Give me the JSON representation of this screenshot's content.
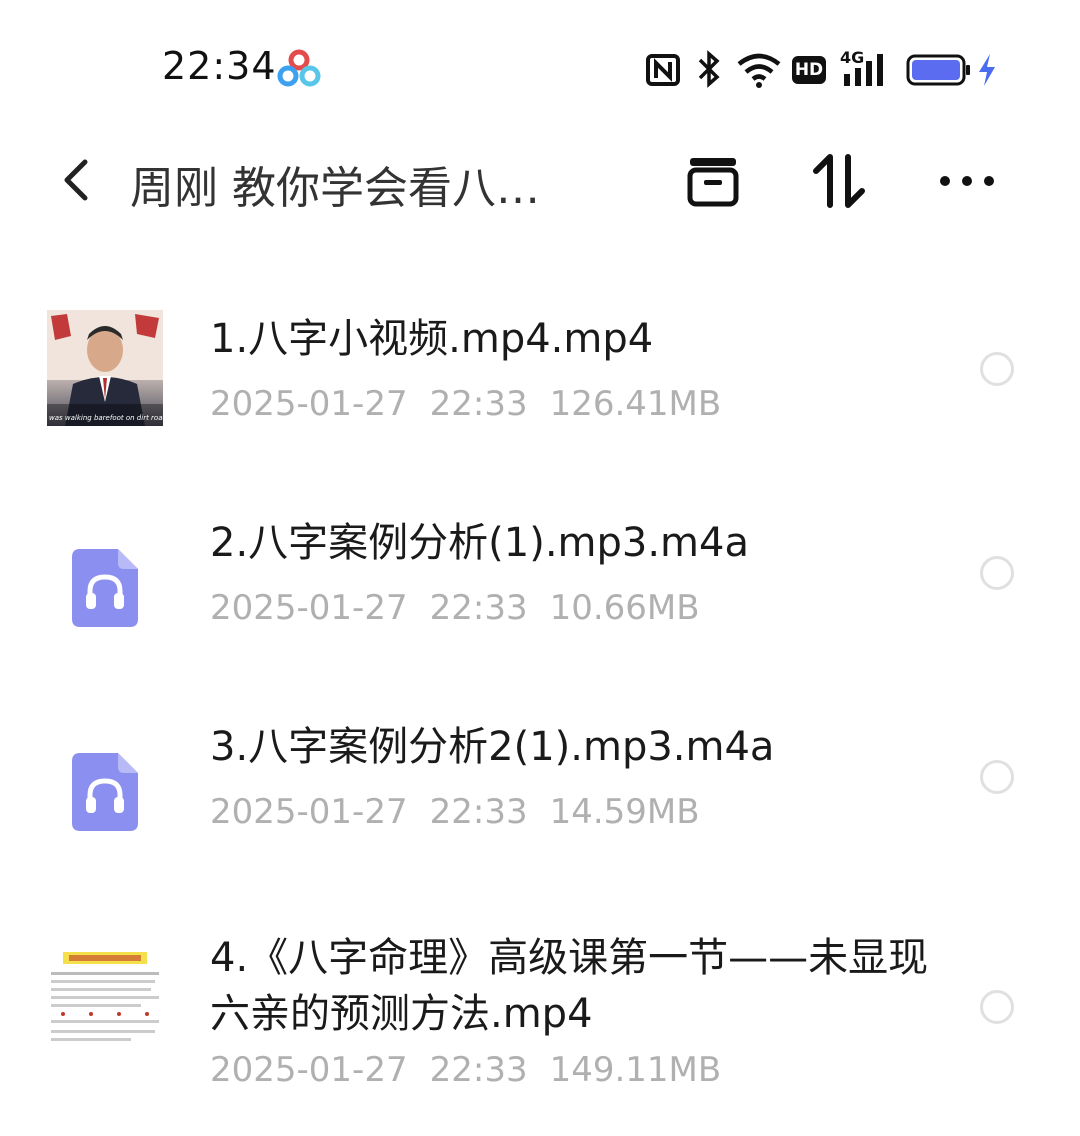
{
  "status_bar": {
    "time": "22:34",
    "icons": [
      "nfc-icon",
      "bluetooth-icon",
      "wifi-icon",
      "hd-icon",
      "signal-4g-icon",
      "battery-icon",
      "charging-icon"
    ],
    "network_label": "4G",
    "hd_label": "HD"
  },
  "header": {
    "title": "周刚 教你学会看八…",
    "back_icon": "chevron-left-icon",
    "actions": [
      "archive-icon",
      "sort-icon",
      "more-icon"
    ]
  },
  "files": [
    {
      "name": "1.八字小视频.mp4.mp4",
      "date": "2025-01-27",
      "time": "22:33",
      "size": "126.41MB",
      "thumb_type": "video",
      "thumb_caption": "was walking barefoot on dirt road"
    },
    {
      "name": "2.八字案例分析(1).mp3.m4a",
      "date": "2025-01-27",
      "time": "22:33",
      "size": "10.66MB",
      "thumb_type": "audio"
    },
    {
      "name": "3.八字案例分析2(1).mp3.m4a",
      "date": "2025-01-27",
      "time": "22:33",
      "size": "14.59MB",
      "thumb_type": "audio"
    },
    {
      "name": "4.《八字命理》高级课第一节——未显现六亲的预测方法.mp4",
      "date": "2025-01-27",
      "time": "22:33",
      "size": "149.11MB",
      "thumb_type": "document-video"
    }
  ],
  "colors": {
    "audio_icon": "#8b8ff0",
    "radio_border": "#e0e0e0",
    "meta_text": "#b0b0b0",
    "battery_fill": "#5b6cf0",
    "charging": "#4a6cf0"
  }
}
